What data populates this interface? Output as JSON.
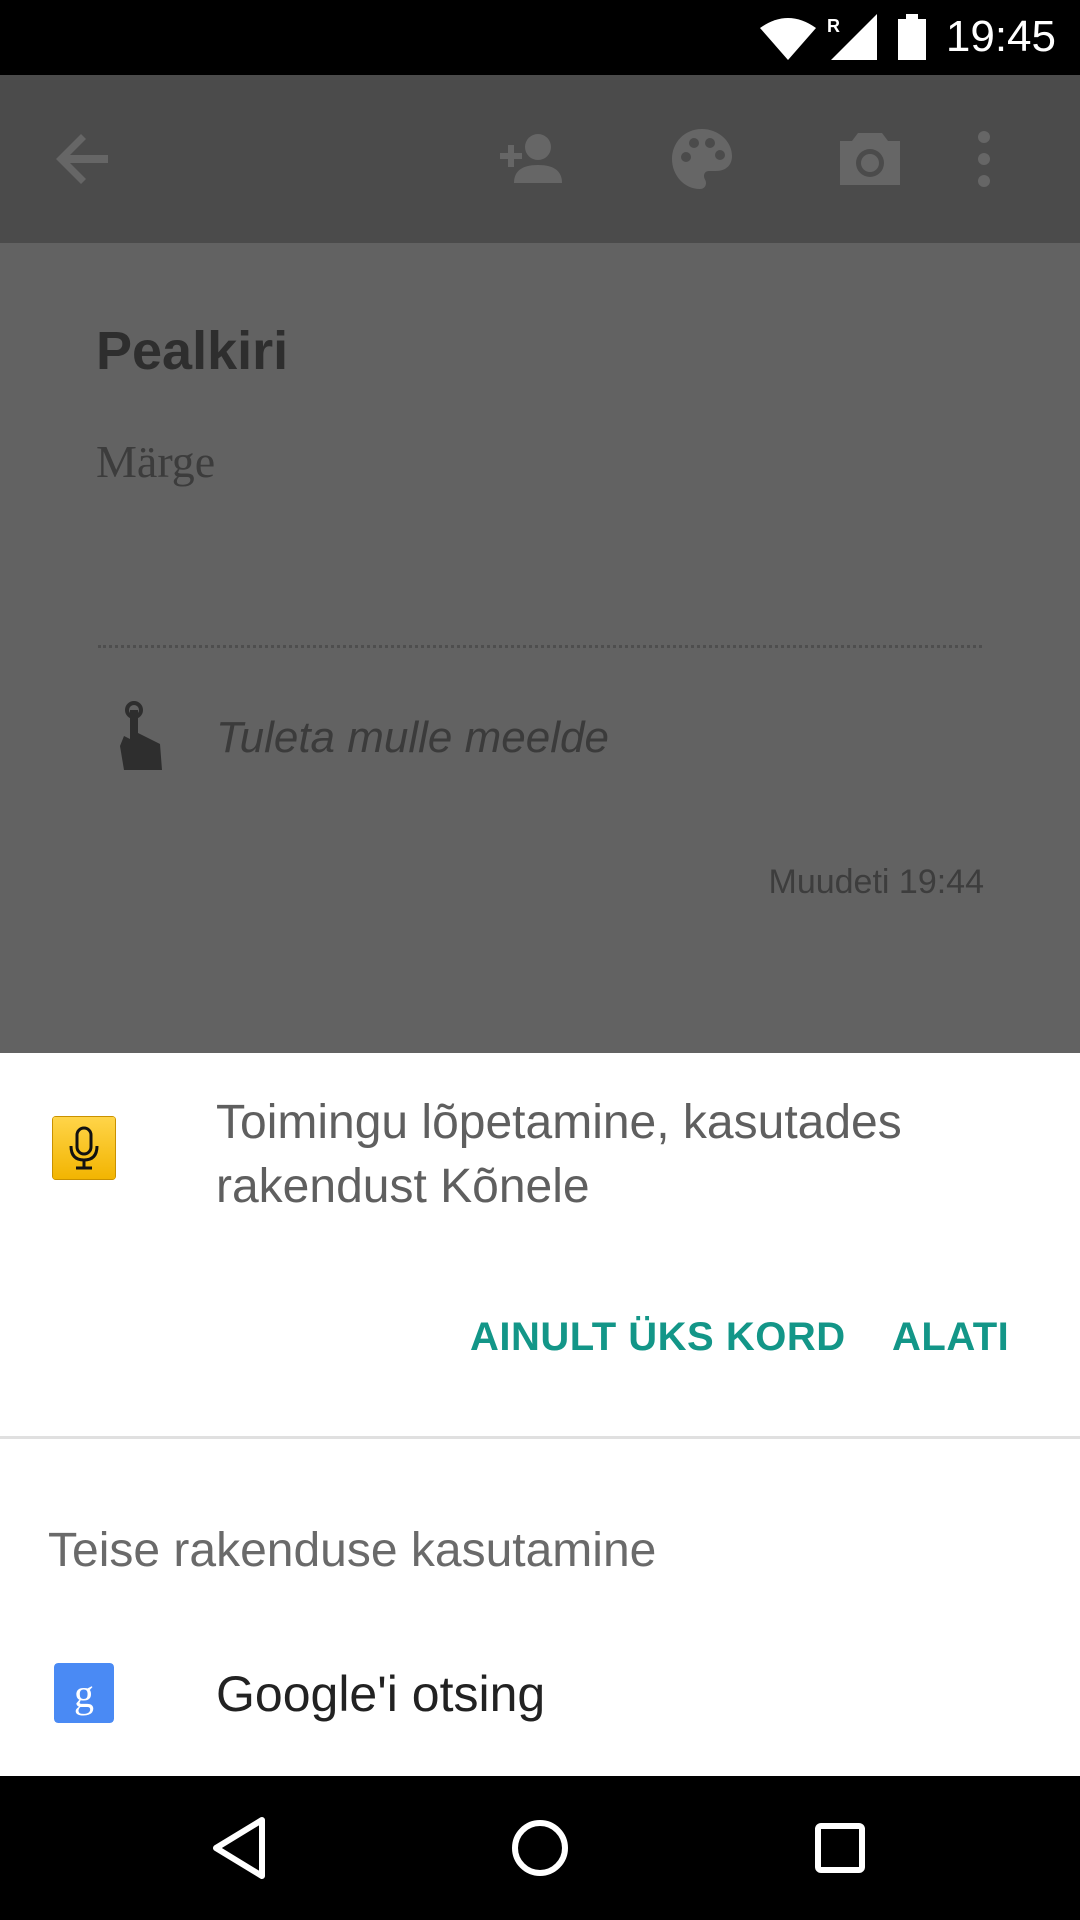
{
  "status_bar": {
    "time": "19:45",
    "icons": [
      "wifi-icon",
      "roaming-signal-icon",
      "battery-icon"
    ],
    "roaming_letter": "R"
  },
  "toolbar": {
    "icons": [
      "back-arrow-icon",
      "add-collaborator-icon",
      "palette-icon",
      "camera-icon",
      "more-vert-icon"
    ]
  },
  "note": {
    "title_placeholder": "Pealkiri",
    "body_placeholder": "Märge",
    "reminder_label": "Tuleta mulle meelde",
    "modified": "Muudeti 19:44"
  },
  "chooser": {
    "title": "Toimingu lõpetamine, kasutades rakendust Kõnele",
    "button_once": "AINULT ÜKS KORD",
    "button_always": "ALATI",
    "other_header": "Teise rakenduse kasutamine",
    "apps": [
      {
        "label": "Google'i otsing",
        "icon": "google-search-icon",
        "icon_letter": "g"
      }
    ]
  },
  "colors": {
    "accent": "#139688",
    "scrim": "#626262",
    "toolbar": "#4b4b4b"
  },
  "nav_bar": {
    "icons": [
      "back-nav-icon",
      "home-nav-icon",
      "recents-nav-icon"
    ]
  }
}
